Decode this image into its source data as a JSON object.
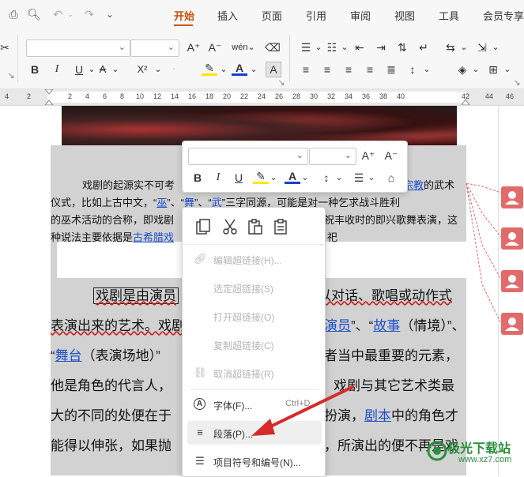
{
  "menu": {
    "tabs": [
      {
        "label": "开始",
        "active": true
      },
      {
        "label": "插入"
      },
      {
        "label": "页面"
      },
      {
        "label": "引用"
      },
      {
        "label": "审阅"
      },
      {
        "label": "视图"
      },
      {
        "label": "工具"
      },
      {
        "label": "会员专享"
      }
    ]
  },
  "ribbon": {
    "bold": "B",
    "italic": "I",
    "underline": "U",
    "superscript": "X²",
    "char_shade": "A"
  },
  "ruler": {
    "numbers": [
      "4",
      "2",
      "2",
      "4",
      "6",
      "8",
      "10",
      "12",
      "14",
      "16",
      "18",
      "20",
      "22",
      "24",
      "26",
      "28",
      "30",
      "32",
      "34",
      "36",
      "38",
      "40",
      "42",
      "44",
      "46"
    ]
  },
  "doc": {
    "p1": {
      "l1_a": "戏剧的起源实不可考",
      "l1_b": "宗教",
      "l1_c": "的武术",
      "l2_a": "仪式，比如上古中文，“",
      "l2_b": "巫",
      "l2_c": "”、“",
      "l2_d": "舞",
      "l2_e": "”、“",
      "l2_f": "武",
      "l2_g": "”三字同源，可能是对一种乞求战斗胜利",
      "l3_a": "的巫术活动的合称，即戏剧",
      "l3_b": "祝丰收时的即兴歌舞表演，这",
      "l4_a": "种说法主要依据是",
      "l4_b": "古希腊戏",
      "l4_c": "祀"
    },
    "p2": {
      "l1_a": "戏剧是由演员",
      "l1_b": "以对话、歌唱或动作式",
      "l2_a": "表演出来的艺术。戏剧",
      "l2_b": "演员",
      "l2_c": "”、“",
      "l2_d": "故事",
      "l2_e": "（情境）”、",
      "l3_a": "“",
      "l3_b": "舞台",
      "l3_c": "（表演场地）”",
      "l3_d": "者当中最重要的元素，",
      "l4_a": "他是角色的代言人，",
      "l4_b": "戏剧与其它艺术类最",
      "l5_a": "大的不同的处便在于",
      "l5_b": "扮演，",
      "l5_c": "剧本",
      "l5_d": "中的角色才",
      "l6_a": "能得以伸张，如果抛",
      "l6_b": "，所演出的便不再是戏"
    }
  },
  "mini_toolbar": {
    "grow": "A⁺",
    "shrink": "A⁻",
    "bold": "B",
    "italic": "I",
    "underline": "U"
  },
  "context_menu": {
    "items": [
      {
        "label": "编辑超链接(H)...",
        "disabled": true
      },
      {
        "label": "选定超链接(S)",
        "disabled": true
      },
      {
        "label": "打开超链接(O)",
        "disabled": true
      },
      {
        "label": "复制超链接(C)",
        "disabled": true
      },
      {
        "label": "取消超链接(R)",
        "disabled": true
      },
      {
        "label": "字体(F)...",
        "shortcut": "Ctrl+D"
      },
      {
        "label": "段落(P)..."
      },
      {
        "label": "项目符号和编号(N)..."
      }
    ]
  },
  "watermark": {
    "line1": "极光下载站",
    "line2": "www.xz7.com"
  },
  "colors": {
    "accent": "#c8520a",
    "link": "#1f4fc9",
    "comment": "#e36a6a",
    "arrow": "#d62a2a",
    "highlight": "#ffe600",
    "font_color": "#1b3fd1"
  }
}
